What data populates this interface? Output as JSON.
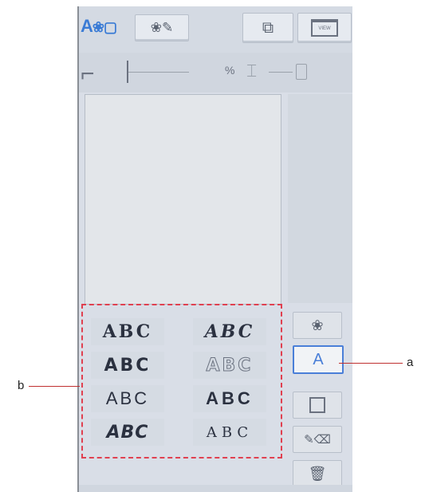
{
  "top_bar": {
    "mode_letter": "A",
    "mode_icons": "❀▢",
    "embroidery_edit": "❀✎",
    "layer_icon": "⧉",
    "view_label": "VIEW"
  },
  "sub_bar": {
    "machine_icon": "⌐",
    "percent": "%",
    "spool_icon": "⌶"
  },
  "fonts": [
    {
      "sample": "ABC"
    },
    {
      "sample": "ABC"
    },
    {
      "sample": "ABC"
    },
    {
      "sample": "ABC"
    },
    {
      "sample": "ABC"
    },
    {
      "sample": "ABC"
    },
    {
      "sample": "ABC"
    },
    {
      "sample": "ABC"
    }
  ],
  "side_buttons": {
    "pattern": "❀",
    "text": "A",
    "edit": "✎⌫",
    "delete": "🗑"
  },
  "callouts": {
    "a": "a",
    "b": "b"
  },
  "colors": {
    "accent": "#4a7fd8",
    "callout": "#c03030"
  }
}
